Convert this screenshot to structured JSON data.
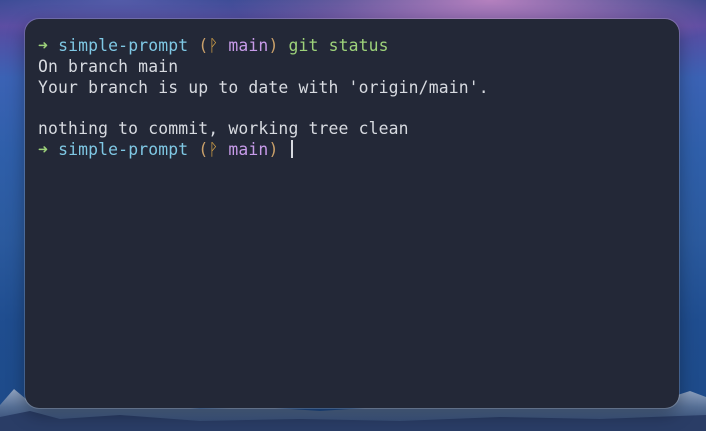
{
  "terminal": {
    "prompt": {
      "arrow": "➜",
      "directory": "simple-prompt",
      "paren_open": "(",
      "branch_icon": "ᚹ",
      "branch": "main",
      "paren_close": ")"
    },
    "command": "git status",
    "output": [
      "On branch main",
      "Your branch is up to date with 'origin/main'.",
      "",
      "nothing to commit, working tree clean"
    ]
  },
  "colors": {
    "terminal_background": "#232837",
    "arrow": "#9dd27a",
    "directory": "#7fc8e4",
    "branch": "#c79be9",
    "command": "#9dd27a",
    "text": "#d7dae0"
  }
}
